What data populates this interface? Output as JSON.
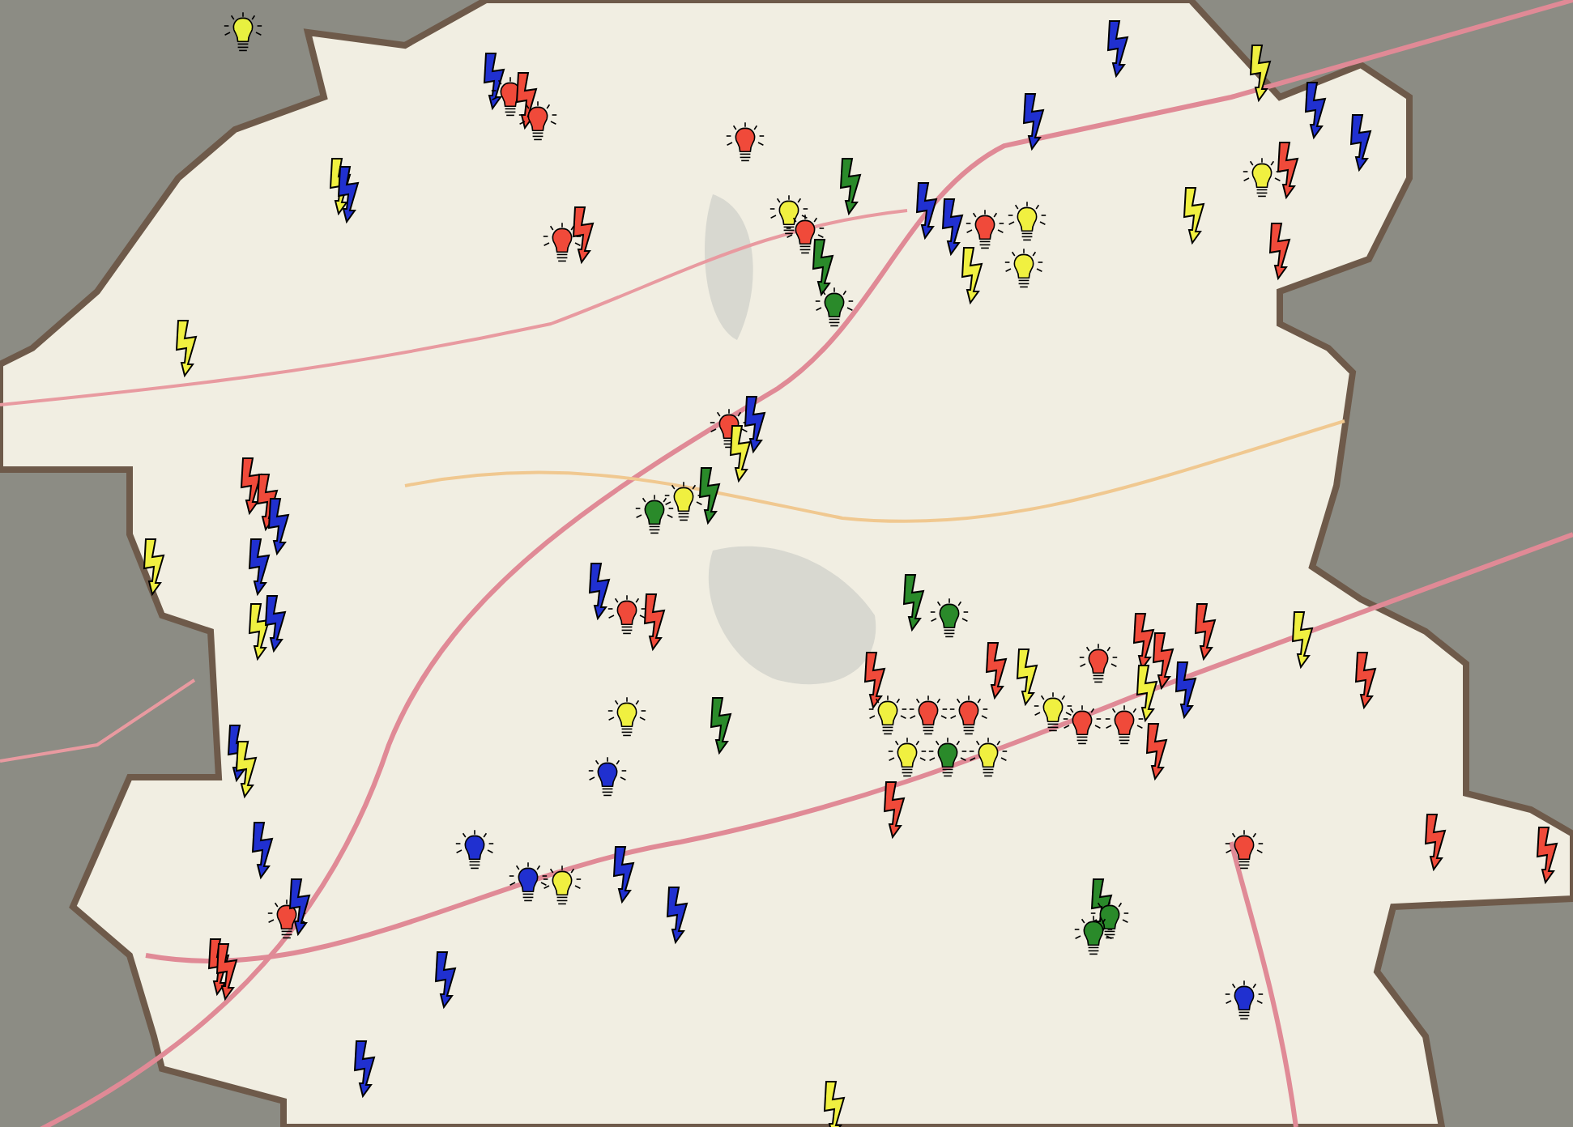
{
  "markers": [
    {
      "kind": "bulb",
      "color": "#e8f040"
    },
    {
      "kind": "bolt",
      "color": "#2030d0"
    },
    {
      "kind": "bulb",
      "color": "#f04a3a"
    },
    {
      "kind": "bolt",
      "color": "#f04a3a"
    },
    {
      "kind": "bulb",
      "color": "#f04a3a"
    },
    {
      "kind": "bulb",
      "color": "#f04a3a"
    },
    {
      "kind": "bolt",
      "color": "#f0f040"
    },
    {
      "kind": "bolt",
      "color": "#2030d0"
    },
    {
      "kind": "bulb",
      "color": "#f04a3a"
    },
    {
      "kind": "bolt",
      "color": "#f04a3a"
    },
    {
      "kind": "bolt",
      "color": "#f0f040"
    },
    {
      "kind": "bulb",
      "color": "#f0f040"
    },
    {
      "kind": "bulb",
      "color": "#f04a3a"
    },
    {
      "kind": "bolt",
      "color": "#2a8a2a"
    },
    {
      "kind": "bolt",
      "color": "#2a8a2a"
    },
    {
      "kind": "bulb",
      "color": "#2a8a2a"
    },
    {
      "kind": "bolt",
      "color": "#2030d0"
    },
    {
      "kind": "bolt",
      "color": "#2030d0"
    },
    {
      "kind": "bolt",
      "color": "#f0f040"
    },
    {
      "kind": "bolt",
      "color": "#2030d0"
    },
    {
      "kind": "bolt",
      "color": "#2030d0"
    },
    {
      "kind": "bulb",
      "color": "#f0f040"
    },
    {
      "kind": "bolt",
      "color": "#f04a3a"
    },
    {
      "kind": "bolt",
      "color": "#f0f040"
    },
    {
      "kind": "bolt",
      "color": "#f04a3a"
    },
    {
      "kind": "bolt",
      "color": "#2030d0"
    },
    {
      "kind": "bolt",
      "color": "#2030d0"
    },
    {
      "kind": "bulb",
      "color": "#f04a3a"
    },
    {
      "kind": "bulb",
      "color": "#f0f040"
    },
    {
      "kind": "bolt",
      "color": "#f0f040"
    },
    {
      "kind": "bulb",
      "color": "#f0f040"
    },
    {
      "kind": "bulb",
      "color": "#f04a3a"
    },
    {
      "kind": "bolt",
      "color": "#2030d0"
    },
    {
      "kind": "bolt",
      "color": "#f0f040"
    },
    {
      "kind": "bulb",
      "color": "#2a8a2a"
    },
    {
      "kind": "bulb",
      "color": "#f0f040"
    },
    {
      "kind": "bolt",
      "color": "#2a8a2a"
    },
    {
      "kind": "bolt",
      "color": "#f04a3a"
    },
    {
      "kind": "bolt",
      "color": "#f04a3a"
    },
    {
      "kind": "bolt",
      "color": "#2030d0"
    },
    {
      "kind": "bolt",
      "color": "#2030d0"
    },
    {
      "kind": "bolt",
      "color": "#f0f040"
    },
    {
      "kind": "bolt",
      "color": "#f0f040"
    },
    {
      "kind": "bolt",
      "color": "#2030d0"
    },
    {
      "kind": "bolt",
      "color": "#2030d0"
    },
    {
      "kind": "bulb",
      "color": "#f04a3a"
    },
    {
      "kind": "bolt",
      "color": "#f04a3a"
    },
    {
      "kind": "bulb",
      "color": "#f0f040"
    },
    {
      "kind": "bolt",
      "color": "#2a8a2a"
    },
    {
      "kind": "bulb",
      "color": "#2030d0"
    },
    {
      "kind": "bolt",
      "color": "#2030d0"
    },
    {
      "kind": "bolt",
      "color": "#f0f040"
    },
    {
      "kind": "bolt",
      "color": "#2030d0"
    },
    {
      "kind": "bulb",
      "color": "#f04a3a"
    },
    {
      "kind": "bolt",
      "color": "#2030d0"
    },
    {
      "kind": "bolt",
      "color": "#f04a3a"
    },
    {
      "kind": "bolt",
      "color": "#f04a3a"
    },
    {
      "kind": "bulb",
      "color": "#2030d0"
    },
    {
      "kind": "bulb",
      "color": "#2030d0"
    },
    {
      "kind": "bulb",
      "color": "#f0f040"
    },
    {
      "kind": "bolt",
      "color": "#2030d0"
    },
    {
      "kind": "bolt",
      "color": "#2030d0"
    },
    {
      "kind": "bolt",
      "color": "#2030d0"
    },
    {
      "kind": "bolt",
      "color": "#2030d0"
    },
    {
      "kind": "bolt",
      "color": "#f0f040"
    },
    {
      "kind": "bolt",
      "color": "#2a8a2a"
    },
    {
      "kind": "bulb",
      "color": "#2a8a2a"
    },
    {
      "kind": "bolt",
      "color": "#f04a3a"
    },
    {
      "kind": "bolt",
      "color": "#f04a3a"
    },
    {
      "kind": "bulb",
      "color": "#f0f040"
    },
    {
      "kind": "bulb",
      "color": "#f04a3a"
    },
    {
      "kind": "bulb",
      "color": "#f0f040"
    },
    {
      "kind": "bulb",
      "color": "#f04a3a"
    },
    {
      "kind": "bulb",
      "color": "#2a8a2a"
    },
    {
      "kind": "bulb",
      "color": "#f0f040"
    },
    {
      "kind": "bolt",
      "color": "#f0f040"
    },
    {
      "kind": "bulb",
      "color": "#f0f040"
    },
    {
      "kind": "bulb",
      "color": "#f04a3a"
    },
    {
      "kind": "bulb",
      "color": "#f04a3a"
    },
    {
      "kind": "bulb",
      "color": "#f04a3a"
    },
    {
      "kind": "bolt",
      "color": "#f04a3a"
    },
    {
      "kind": "bolt",
      "color": "#f04a3a"
    },
    {
      "kind": "bolt",
      "color": "#2030d0"
    },
    {
      "kind": "bolt",
      "color": "#f0f040"
    },
    {
      "kind": "bolt",
      "color": "#f04a3a"
    },
    {
      "kind": "bolt",
      "color": "#f04a3a"
    },
    {
      "kind": "bolt",
      "color": "#f0f040"
    },
    {
      "kind": "bolt",
      "color": "#f04a3a"
    },
    {
      "kind": "bolt",
      "color": "#f04a3a"
    },
    {
      "kind": "bulb",
      "color": "#f04a3a"
    },
    {
      "kind": "bolt",
      "color": "#f04a3a"
    },
    {
      "kind": "bolt",
      "color": "#f04a3a"
    },
    {
      "kind": "bolt",
      "color": "#2a8a2a"
    },
    {
      "kind": "bulb",
      "color": "#2a8a2a"
    },
    {
      "kind": "bulb",
      "color": "#2a8a2a"
    },
    {
      "kind": "bulb",
      "color": "#2030d0"
    }
  ]
}
